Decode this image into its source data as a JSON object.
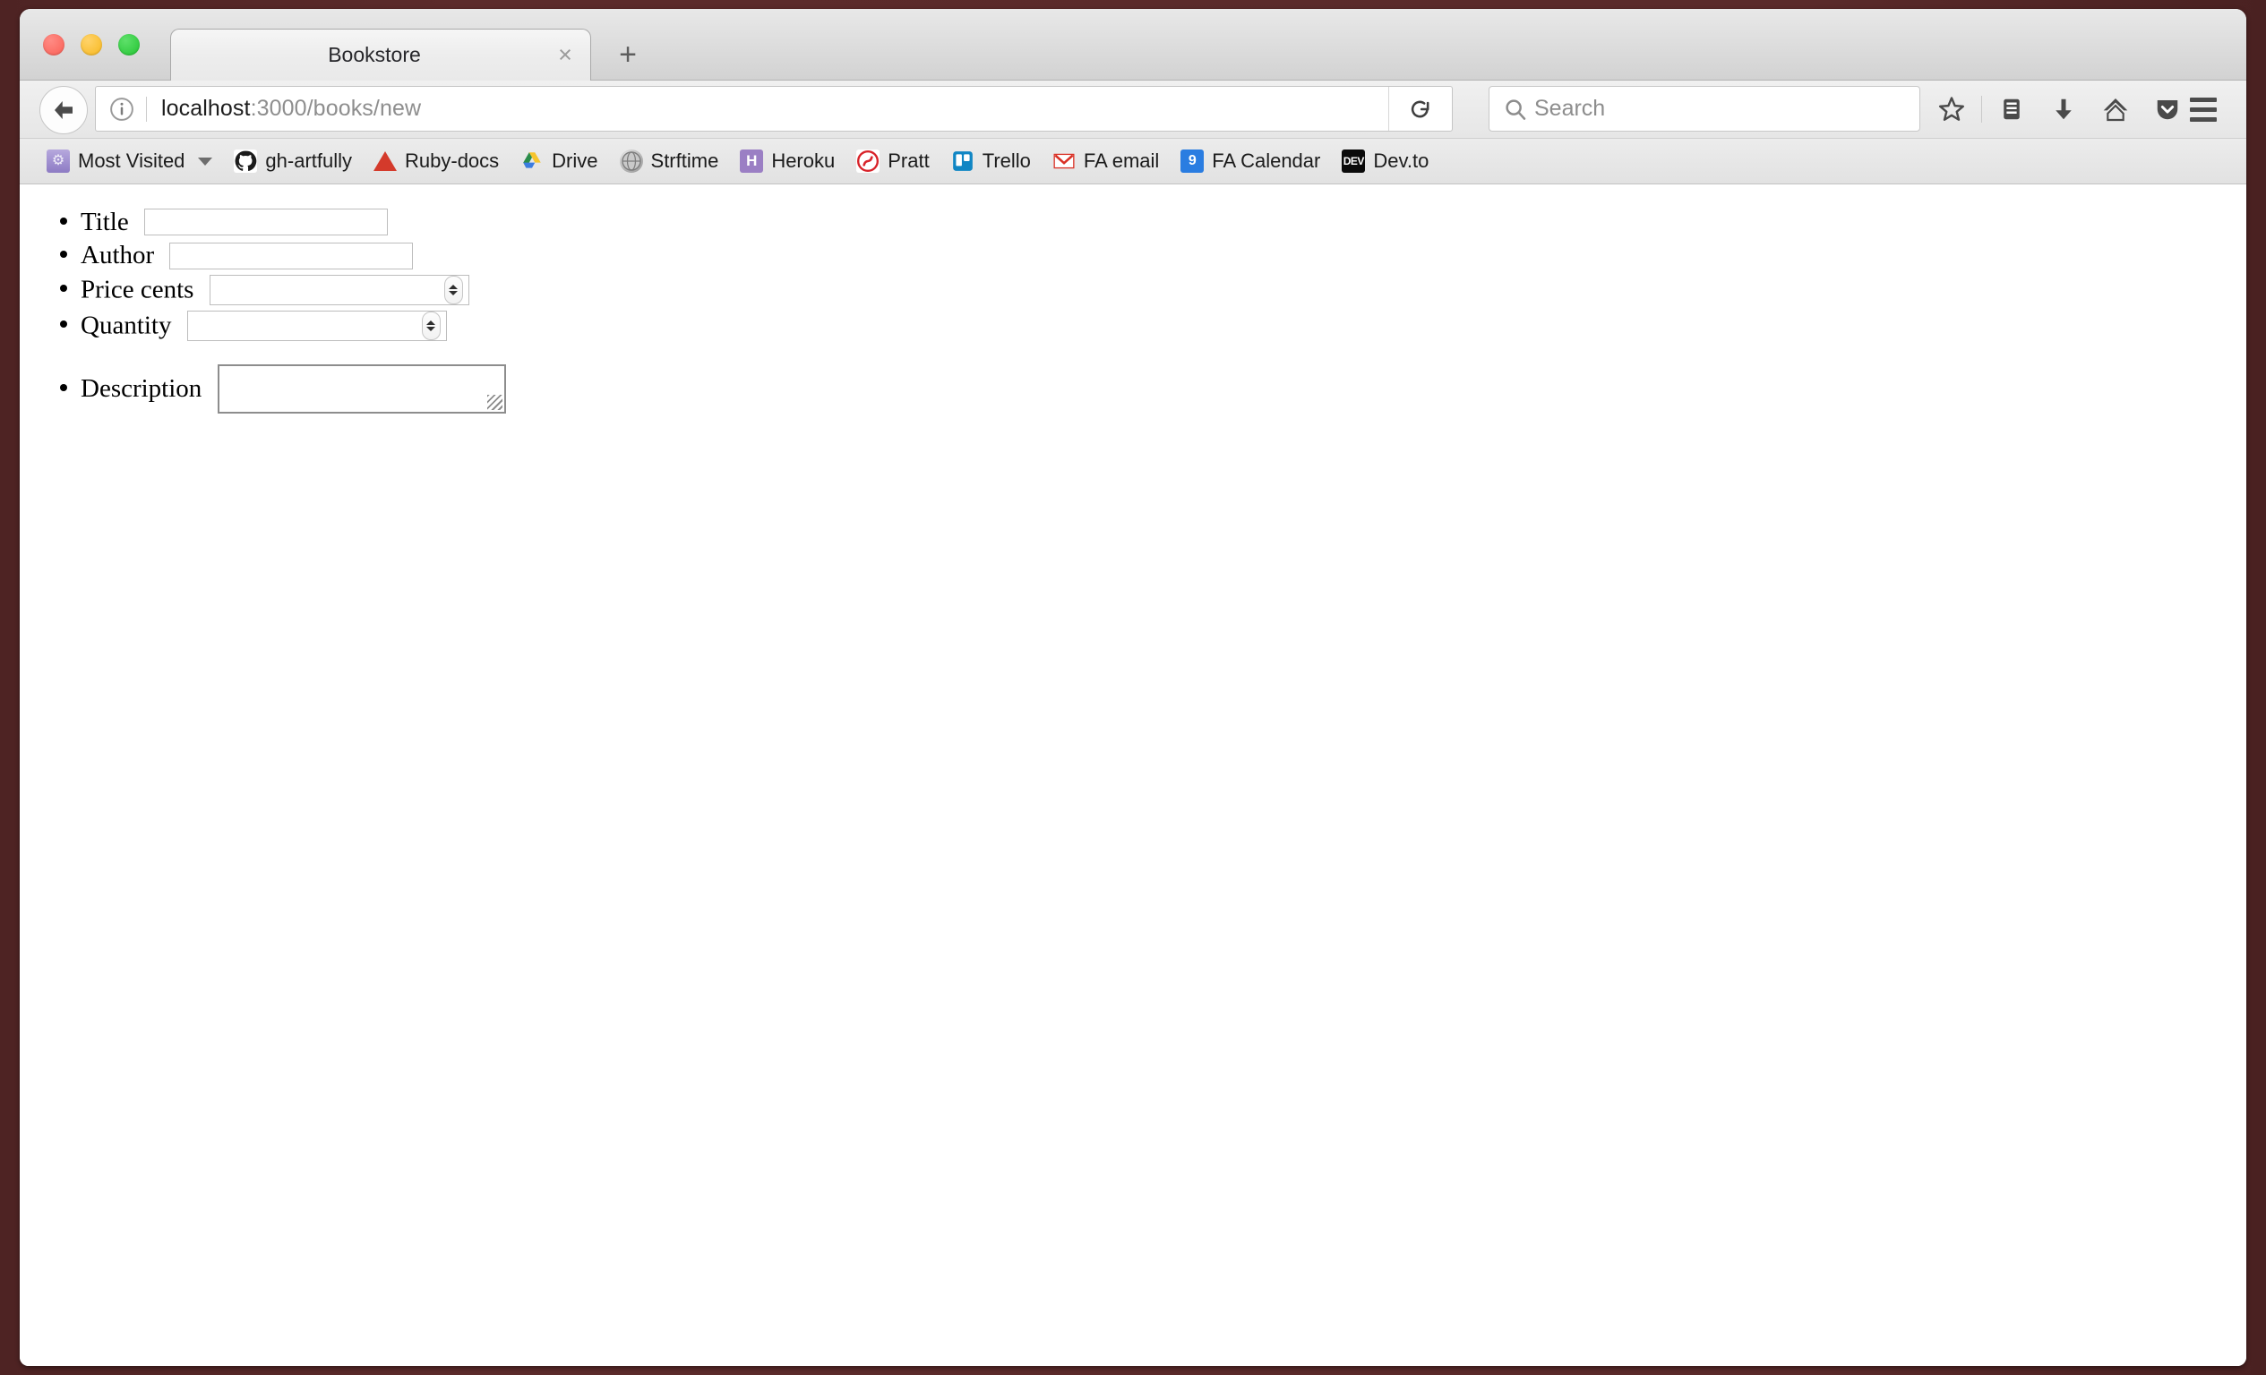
{
  "window": {
    "frame_color": "#5a2a2a",
    "traffic_lights": [
      {
        "name": "close",
        "color": "#fa5f55"
      },
      {
        "name": "minimize",
        "color": "#f7b71d"
      },
      {
        "name": "zoom",
        "color": "#22c431"
      }
    ]
  },
  "tabs": [
    {
      "title": "Bookstore",
      "close_glyph": "×",
      "active": true
    }
  ],
  "new_tab_glyph": "+",
  "navigation": {
    "back_glyph": "←",
    "reload_glyph": "⟳",
    "info_glyph": "ⓘ",
    "url": {
      "host": "localhost",
      "path": ":3000/books/new",
      "full": "localhost:3000/books/new"
    },
    "search": {
      "placeholder": "Search",
      "icon": "search-icon"
    },
    "toolbar_icons": [
      {
        "name": "bookmark-star-icon",
        "glyph": "☆"
      },
      {
        "name": "reading-list-icon",
        "glyph": "☰"
      },
      {
        "name": "downloads-icon",
        "glyph": "⬇"
      },
      {
        "name": "home-icon",
        "glyph": "⌂"
      },
      {
        "name": "pocket-icon",
        "glyph": "▼"
      }
    ],
    "menu_icon": "hamburger-menu-icon"
  },
  "bookmarks": [
    {
      "label": "Most Visited",
      "icon": "folder-gear-icon",
      "has_caret": true
    },
    {
      "label": "gh-artfully",
      "icon": "github-icon",
      "glyph": "●"
    },
    {
      "label": "Ruby-docs",
      "icon": "ruby-icon",
      "glyph": ""
    },
    {
      "label": "Drive",
      "icon": "google-drive-icon",
      "glyph": ""
    },
    {
      "label": "Strftime",
      "icon": "globe-icon",
      "glyph": "◌"
    },
    {
      "label": "Heroku",
      "icon": "heroku-icon",
      "glyph": "H"
    },
    {
      "label": "Pratt",
      "icon": "pratt-icon",
      "glyph": "@"
    },
    {
      "label": "Trello",
      "icon": "trello-icon",
      "glyph": "▐▐"
    },
    {
      "label": "FA email",
      "icon": "gmail-icon",
      "glyph": "M"
    },
    {
      "label": "FA Calendar",
      "icon": "google-calendar-icon",
      "glyph": "9"
    },
    {
      "label": "Dev.to",
      "icon": "devto-icon",
      "glyph": "DEV"
    }
  ],
  "page": {
    "form_fields": [
      {
        "label": "Title",
        "type": "text",
        "value": "",
        "name": "title"
      },
      {
        "label": "Author",
        "type": "text",
        "value": "",
        "name": "author"
      },
      {
        "label": "Price cents",
        "type": "number",
        "value": "",
        "name": "price_cents"
      },
      {
        "label": "Quantity",
        "type": "number",
        "value": "",
        "name": "quantity"
      },
      {
        "label": "Description",
        "type": "textarea",
        "value": "",
        "name": "description"
      }
    ]
  }
}
